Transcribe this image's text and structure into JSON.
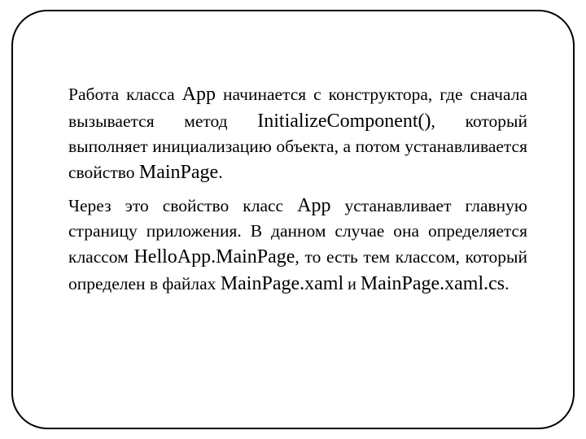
{
  "p1": {
    "t1": "Работа класса ",
    "k1": "App",
    "t2": " начинается с конструктора, где сначала вызывается метод ",
    "k2": "InitializeComponent()",
    "t3": ", который выполняет инициализацию объекта, а потом устанавливается свойство ",
    "k3": "MainPage",
    "t4": "."
  },
  "p2": {
    "t1": "Через это свойство класс ",
    "k1": "App",
    "t2": " устанавливает главную страницу приложения. В данном случае она определяется классом ",
    "k2": "HelloApp.MainPage",
    "t3": ", то есть тем классом, который определен в файлах ",
    "k3": "MainPage.xaml",
    "t4": " и ",
    "k4": "MainPage.xaml.cs",
    "t5": "."
  }
}
